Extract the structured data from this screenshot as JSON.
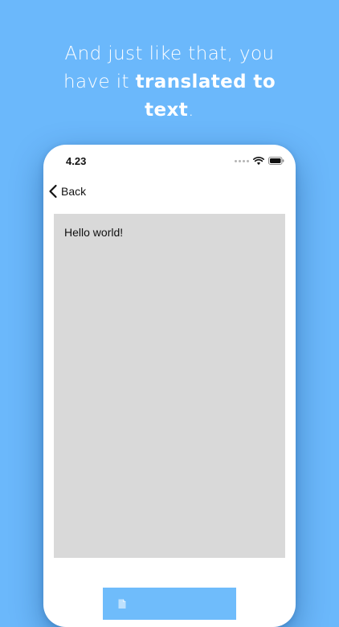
{
  "headline": {
    "line1": "And just like that, you",
    "line2_prefix": "have it ",
    "line2_bold": "translated to",
    "line3_bold": "text",
    "line3_suffix": "."
  },
  "status_bar": {
    "time": "4.23",
    "icons": [
      "signal-dots-icon",
      "wifi-icon",
      "battery-icon"
    ]
  },
  "nav": {
    "back_label": "Back",
    "back_icon": "chevron-left-icon"
  },
  "content": {
    "translated_text": "Hello world!"
  },
  "action_button": {
    "icon": "document-icon"
  },
  "colors": {
    "background": "#6bb8fb",
    "text_area": "#d9d9d9",
    "button": "#6fbcfb",
    "headline_text": "#ffffff"
  }
}
